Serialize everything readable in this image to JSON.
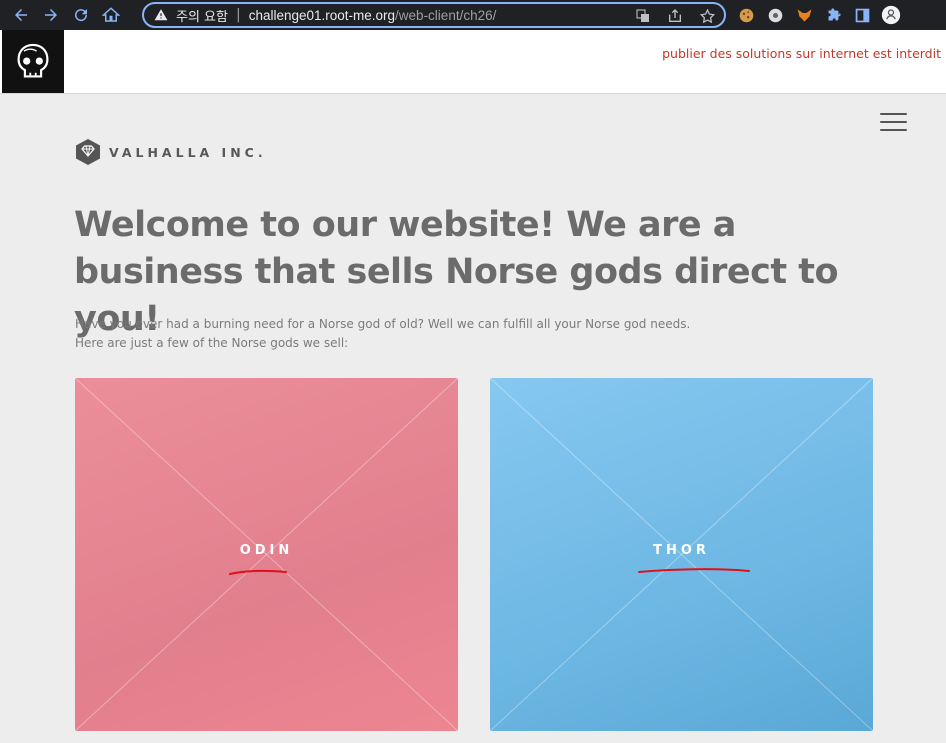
{
  "browser": {
    "security_label": "주의 요함",
    "url_host": "challenge01.root-me.org",
    "url_path": "/web-client/ch26/"
  },
  "rootme": {
    "notice": "publier des solutions sur internet est interdit"
  },
  "site": {
    "brand": "VALHALLA INC.",
    "headline": "Welcome to our website! We are a business that sells Norse gods direct to you!",
    "intro_line1": "Have you ever had a burning need for a Norse god of old? Well we can fulfill all your Norse god needs.",
    "intro_line2": "Here are just a few of the Norse gods we sell:",
    "tiles": [
      {
        "label": "ODIN",
        "color": "#e6828f"
      },
      {
        "label": "THOR",
        "color": "#74bbe6"
      }
    ]
  },
  "colors": {
    "chrome": "#202124",
    "accent": "#8ab4f8",
    "notice": "#c0392b",
    "text": "#6b6b6b",
    "annotation": "#e0101a"
  }
}
